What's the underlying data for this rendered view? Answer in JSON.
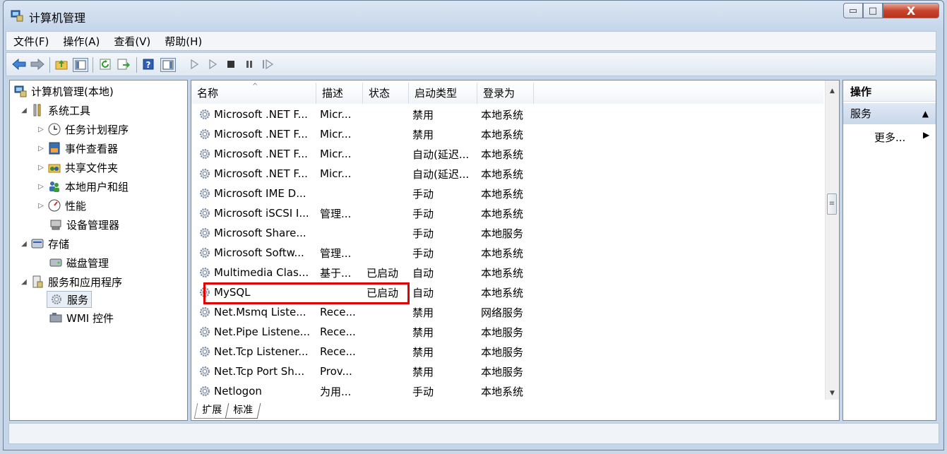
{
  "window": {
    "title": "计算机管理",
    "minimize_glyph": "▭",
    "maximize_glyph": "□",
    "close_glyph": "X"
  },
  "menu": [
    "文件(F)",
    "操作(A)",
    "查看(V)",
    "帮助(H)"
  ],
  "toolbar": {
    "icons": [
      "back-arrow-icon",
      "forward-arrow-icon",
      "up-folder-icon",
      "show-hide-tree-icon",
      "refresh-icon",
      "export-list-icon",
      "help-icon",
      "show-hide-action-pane-icon",
      "start-service-icon",
      "start-service-alt-icon",
      "stop-service-icon",
      "pause-service-icon",
      "restart-service-icon"
    ]
  },
  "tree": {
    "root": "计算机管理(本地)",
    "system_tools": "系统工具",
    "task_scheduler": "任务计划程序",
    "event_viewer": "事件查看器",
    "shared_folders": "共享文件夹",
    "local_users": "本地用户和组",
    "performance": "性能",
    "device_manager": "设备管理器",
    "storage": "存储",
    "disk_management": "磁盘管理",
    "services_apps": "服务和应用程序",
    "services": "服务",
    "wmi": "WMI 控件"
  },
  "columns": {
    "name": "名称",
    "desc": "描述",
    "status": "状态",
    "startup": "启动类型",
    "logon": "登录为"
  },
  "services": [
    {
      "name": "Microsoft .NET F...",
      "desc": "Micr...",
      "status": "",
      "startup": "禁用",
      "logon": "本地系统"
    },
    {
      "name": "Microsoft .NET F...",
      "desc": "Micr...",
      "status": "",
      "startup": "禁用",
      "logon": "本地系统"
    },
    {
      "name": "Microsoft .NET F...",
      "desc": "Micr...",
      "status": "",
      "startup": "自动(延迟...",
      "logon": "本地系统"
    },
    {
      "name": "Microsoft .NET F...",
      "desc": "Micr...",
      "status": "",
      "startup": "自动(延迟...",
      "logon": "本地系统"
    },
    {
      "name": "Microsoft IME D...",
      "desc": "",
      "status": "",
      "startup": "手动",
      "logon": "本地系统"
    },
    {
      "name": "Microsoft iSCSI I...",
      "desc": "管理...",
      "status": "",
      "startup": "手动",
      "logon": "本地系统"
    },
    {
      "name": "Microsoft Share...",
      "desc": "",
      "status": "",
      "startup": "手动",
      "logon": "本地服务"
    },
    {
      "name": "Microsoft Softw...",
      "desc": "管理...",
      "status": "",
      "startup": "手动",
      "logon": "本地系统"
    },
    {
      "name": "Multimedia Clas...",
      "desc": "基于...",
      "status": "已启动",
      "startup": "自动",
      "logon": "本地系统"
    },
    {
      "name": "MySQL",
      "desc": "",
      "status": "已启动",
      "startup": "自动",
      "logon": "本地系统"
    },
    {
      "name": "Net.Msmq Liste...",
      "desc": "Rece...",
      "status": "",
      "startup": "禁用",
      "logon": "网络服务"
    },
    {
      "name": "Net.Pipe Listene...",
      "desc": "Rece...",
      "status": "",
      "startup": "禁用",
      "logon": "本地服务"
    },
    {
      "name": "Net.Tcp Listener...",
      "desc": "Rece...",
      "status": "",
      "startup": "禁用",
      "logon": "本地服务"
    },
    {
      "name": "Net.Tcp Port Sh...",
      "desc": "Prov...",
      "status": "",
      "startup": "禁用",
      "logon": "本地服务"
    },
    {
      "name": "Netlogon",
      "desc": "为用...",
      "status": "",
      "startup": "手动",
      "logon": "本地系统"
    }
  ],
  "tabs": [
    "扩展",
    "标准"
  ],
  "actions": {
    "header": "操作",
    "group": "服务",
    "more": "更多..."
  },
  "colors": {
    "highlight": "#e00000",
    "selection": "#e8eef6"
  }
}
